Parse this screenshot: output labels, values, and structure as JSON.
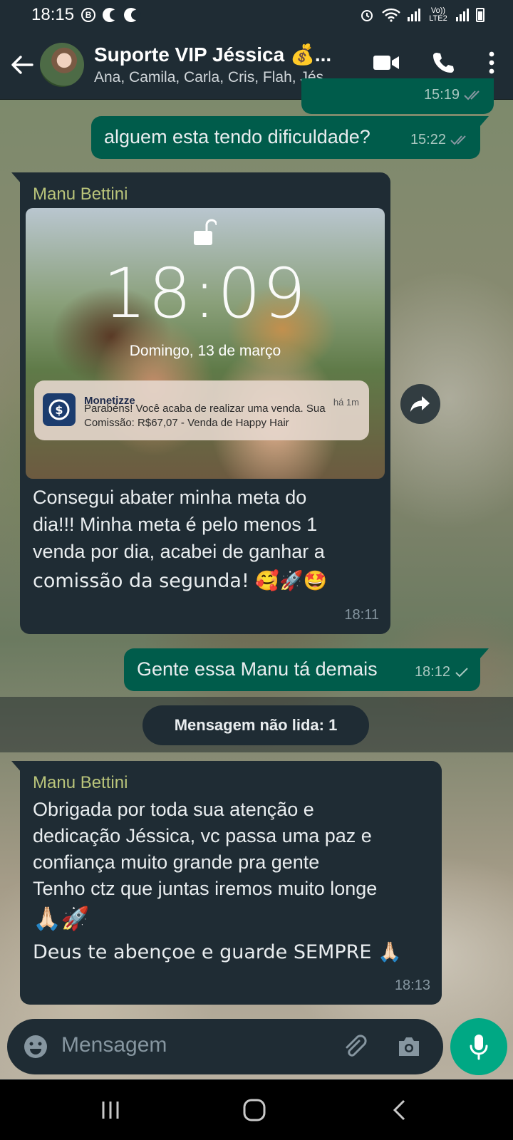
{
  "status_bar": {
    "time": "18:15",
    "network_label": "Vo)) LTE2"
  },
  "header": {
    "title": "Suporte VIP Jéssica 💰...",
    "subtitle": "Ana, Camila, Carla, Cris, Flah, Jés..."
  },
  "messages": [
    {
      "direction": "outgoing",
      "time_partial": "15:19",
      "status": "read"
    },
    {
      "direction": "outgoing",
      "text": "alguem esta tendo dificuldade?",
      "time": "15:22",
      "status": "read"
    },
    {
      "direction": "incoming",
      "sender": "Manu Bettini",
      "image": {
        "lock_time": "18:09",
        "lock_date": "Domingo, 13 de março",
        "notification": {
          "app": "Monetizze",
          "time": "há 1m",
          "text": "Parabéns! Você acaba de realizar uma venda. Sua Comissão: R$67,07 - Venda de Happy Hair"
        }
      },
      "text_lines": [
        "Consegui abater minha meta do",
        "dia!!! Minha meta é pelo menos 1",
        "venda por dia, acabei de ganhar a",
        "comissão da segunda! 🥰🚀🤩"
      ],
      "time": "18:11"
    },
    {
      "direction": "outgoing",
      "text": "Gente essa Manu tá demais",
      "time": "18:12",
      "status": "sent"
    },
    {
      "direction": "incoming",
      "sender": "Manu Bettini",
      "text_lines": [
        "Obrigada por toda sua atenção e",
        "dedicação Jéssica, vc passa uma paz e",
        "confiança muito grande pra gente",
        "Tenho ctz que juntas iremos muito longe",
        "🙏🏻🚀",
        "Deus te abençoe e guarde SEMPRE 🙏🏻"
      ],
      "time": "18:13"
    }
  ],
  "unread_banner": "Mensagem não lida: 1",
  "input": {
    "placeholder": "Mensagem"
  },
  "icons": {
    "back": "arrow-left-icon",
    "video": "video-call-icon",
    "phone": "phone-icon",
    "menu": "more-vertical-icon",
    "emoji": "emoji-icon",
    "attach": "paperclip-icon",
    "camera": "camera-icon",
    "mic": "microphone-icon",
    "forward": "forward-icon"
  },
  "colors": {
    "header_bg": "#1f2c34",
    "outgoing_bubble": "#005c4b",
    "incoming_bubble": "#1f2c34",
    "accent": "#00a884",
    "sender_name": "#b9c47a"
  }
}
